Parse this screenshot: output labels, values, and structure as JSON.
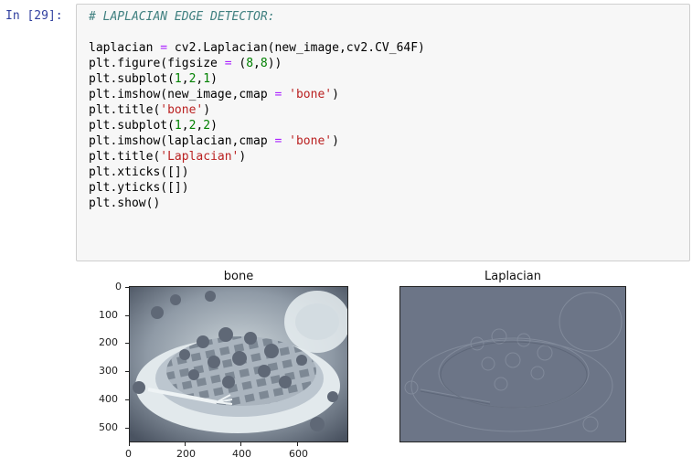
{
  "cell": {
    "prompt": "In [29]:",
    "lines": [
      {
        "kind": "comment",
        "text": "# LAPLACIAN EDGE DETECTOR:"
      },
      {
        "kind": "blank",
        "text": ""
      },
      {
        "kind": "code",
        "text": "laplacian = cv2.Laplacian(new_image,cv2.CV_64F)"
      },
      {
        "kind": "code",
        "text": "plt.figure(figsize = (8,8))"
      },
      {
        "kind": "code",
        "text": "plt.subplot(1,2,1)"
      },
      {
        "kind": "code",
        "text": "plt.imshow(new_image,cmap = 'bone')"
      },
      {
        "kind": "code",
        "text": "plt.title('bone')"
      },
      {
        "kind": "code",
        "text": "plt.subplot(1,2,2)"
      },
      {
        "kind": "code",
        "text": "plt.imshow(laplacian,cmap = 'bone')"
      },
      {
        "kind": "code",
        "text": "plt.title('Laplacian')"
      },
      {
        "kind": "code",
        "text": "plt.xticks([])"
      },
      {
        "kind": "code",
        "text": "plt.yticks([])"
      },
      {
        "kind": "code",
        "text": "plt.show()"
      }
    ]
  },
  "figure": {
    "left_title": "bone",
    "right_title": "Laplacian",
    "yticks": [
      "0",
      "100",
      "200",
      "300",
      "400",
      "500"
    ],
    "xticks": [
      "0",
      "200",
      "400",
      "600"
    ],
    "colors": {
      "bone_dark": "#3b4450",
      "bone_light": "#e6eef0",
      "laplacian_bg": "#6c7587"
    }
  }
}
